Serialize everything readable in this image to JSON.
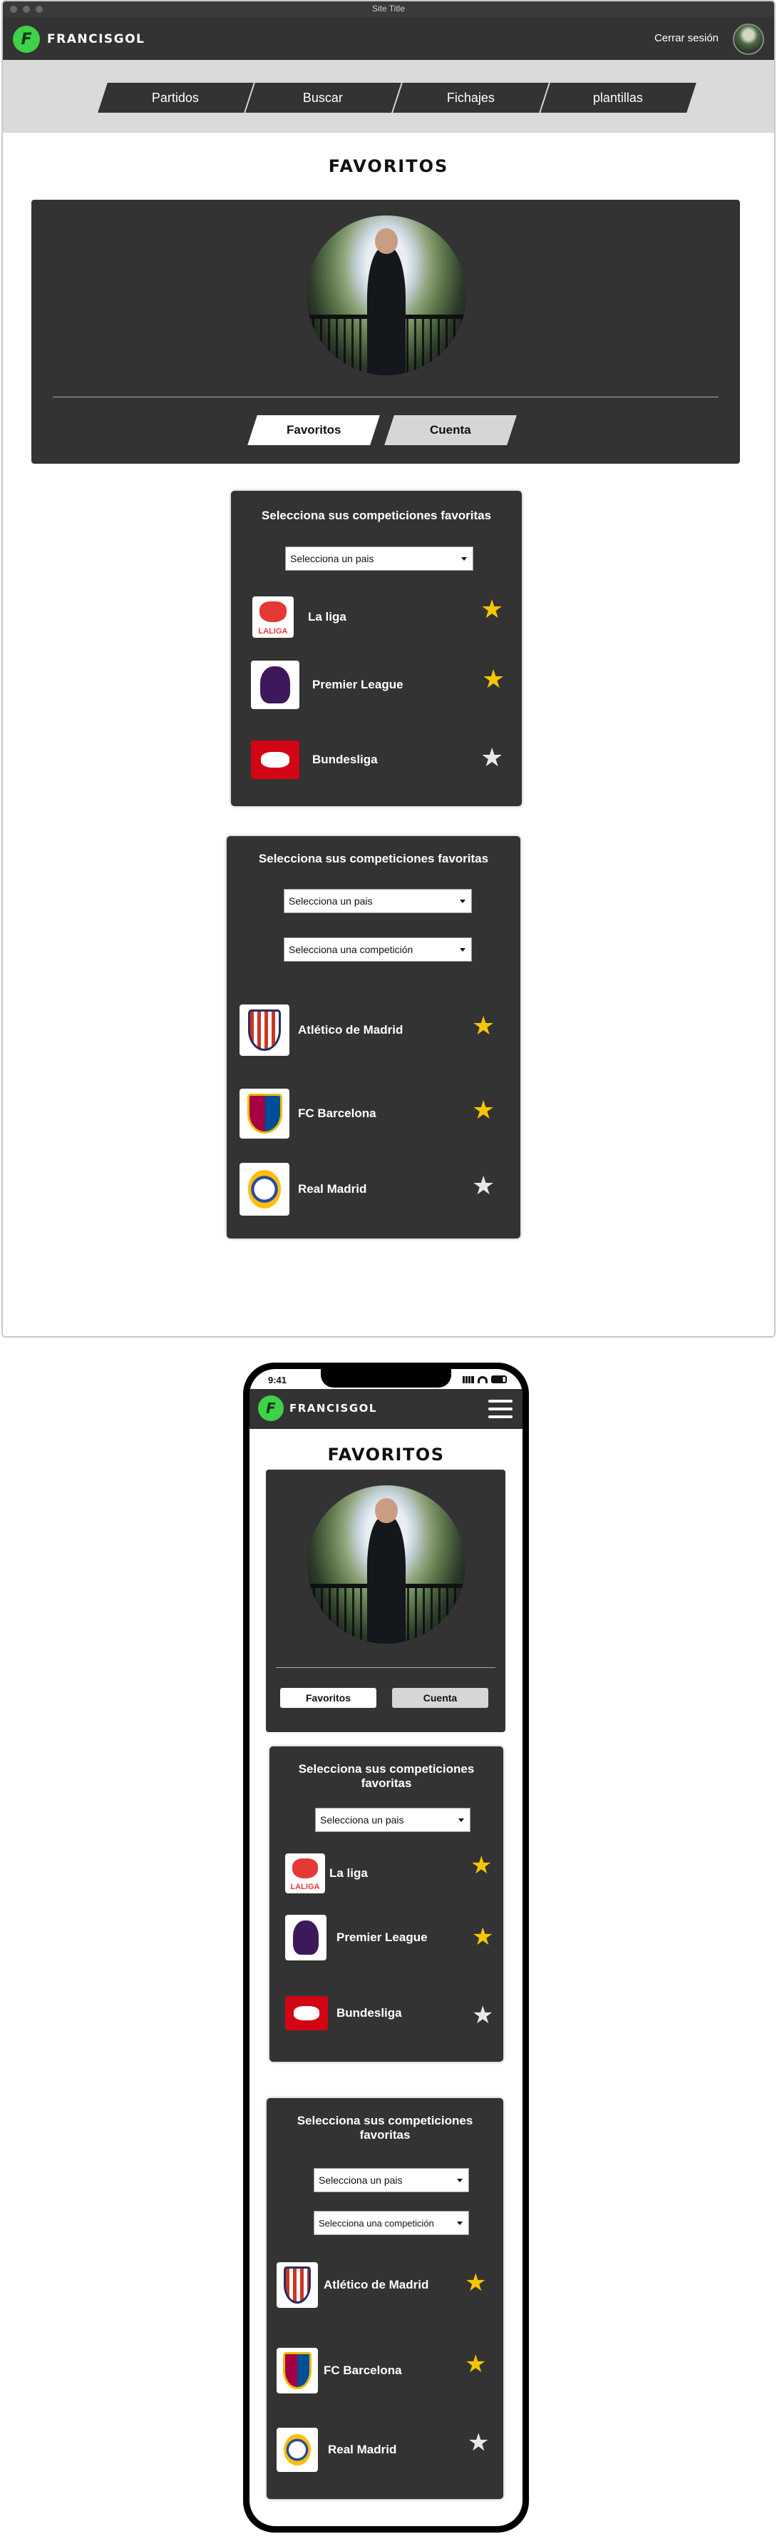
{
  "window": {
    "title": "Site Title"
  },
  "brand": {
    "logo_letter": "F",
    "name": "FRANCISGOL"
  },
  "header": {
    "logout_label": "Cerrar sesión",
    "avatar_alt": "avatar"
  },
  "nav": {
    "items": [
      "Partidos",
      "Buscar",
      "Fichajes",
      "plantillas"
    ]
  },
  "page": {
    "title": "FAVORITOS"
  },
  "profile": {
    "tabs": [
      "Favoritos",
      "Cuenta"
    ],
    "active_tab": "Favoritos"
  },
  "competitions": {
    "title": "Selecciona sus competiciones favoritas",
    "country_placeholder": "Selecciona un pais",
    "items": [
      {
        "name": "La liga",
        "logo": "laliga-logo",
        "logo_text": "LALIGA",
        "favorite": true
      },
      {
        "name": "Premier League",
        "logo": "premier-league-logo",
        "favorite": true
      },
      {
        "name": "Bundesliga",
        "logo": "bundesliga-logo",
        "favorite": false
      }
    ]
  },
  "teams": {
    "title": "Selecciona sus competiciones favoritas",
    "country_placeholder": "Selecciona un pais",
    "competition_placeholder": "Selecciona una competición",
    "items": [
      {
        "name": "Atlético de Madrid",
        "crest": "atletico-madrid-crest",
        "favorite": true
      },
      {
        "name": "FC Barcelona",
        "crest": "fc-barcelona-crest",
        "favorite": true
      },
      {
        "name": "Real Madrid",
        "crest": "real-madrid-crest",
        "favorite": false
      }
    ]
  },
  "mobile": {
    "status_time": "9:41",
    "menu_icon": "hamburger-menu-icon",
    "competition_placeholder_short": "Selecciona una competición"
  },
  "icons": {
    "star": "★"
  },
  "colors": {
    "dark": "#333333",
    "accent_green": "#3fd14a",
    "star_on": "#f7c600",
    "star_off": "#e8e8e8"
  }
}
